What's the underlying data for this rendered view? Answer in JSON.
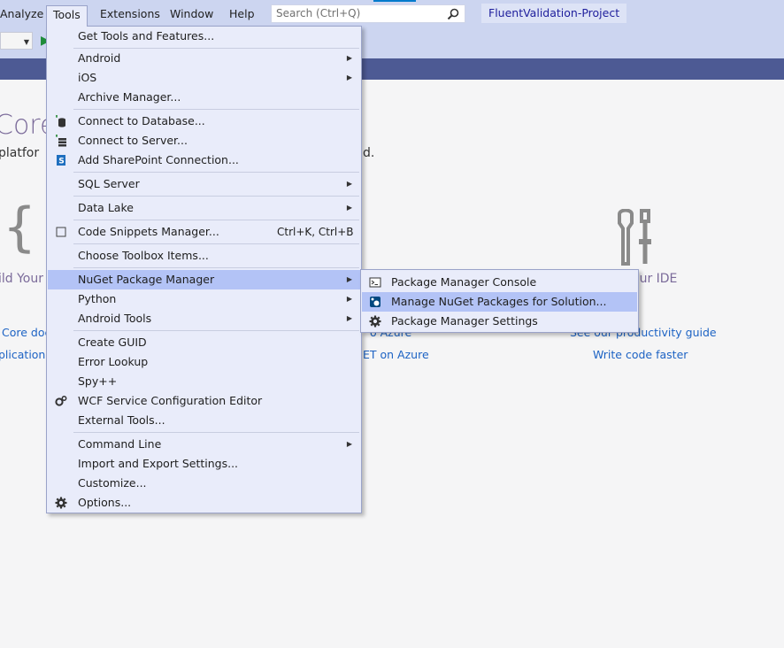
{
  "menubar": {
    "items": [
      {
        "label": "Analyze"
      },
      {
        "label": "Tools"
      },
      {
        "label": "Extensions"
      },
      {
        "label": "Window"
      },
      {
        "label": "Help"
      }
    ],
    "search_placeholder": "Search (Ctrl+Q)",
    "solution_name": "FluentValidation-Project"
  },
  "start_page": {
    "heading": "Core",
    "subtitle_left": "platfor",
    "subtitle_right": "d.",
    "braces": "{ }",
    "build_label": "ild Your",
    "ide_label": "our IDE",
    "links": {
      "core_docs": "Core doc",
      "application": "plication a",
      "azure1": "o Azure",
      "azure2": "ET on Azure",
      "productivity": "See our productivity guide",
      "write_code": "Write code faster"
    }
  },
  "tools_menu": {
    "items": [
      {
        "label": "Get Tools and Features..."
      },
      {
        "label": "Android",
        "submenu": true
      },
      {
        "label": "iOS",
        "submenu": true
      },
      {
        "label": "Archive Manager..."
      },
      {
        "label": "Connect to Database...",
        "icon": "database-icon"
      },
      {
        "label": "Connect to Server...",
        "icon": "server-icon"
      },
      {
        "label": "Add SharePoint Connection...",
        "icon": "sharepoint-icon"
      },
      {
        "label": "SQL Server",
        "submenu": true
      },
      {
        "label": "Data Lake",
        "submenu": true
      },
      {
        "label": "Code Snippets Manager...",
        "shortcut": "Ctrl+K, Ctrl+B",
        "icon": "snippet-icon"
      },
      {
        "label": "Choose Toolbox Items..."
      },
      {
        "label": "NuGet Package Manager",
        "submenu": true,
        "highlighted": true
      },
      {
        "label": "Python",
        "submenu": true
      },
      {
        "label": "Android Tools",
        "submenu": true
      },
      {
        "label": "Create GUID"
      },
      {
        "label": "Error Lookup"
      },
      {
        "label": "Spy++"
      },
      {
        "label": "WCF Service Configuration Editor",
        "icon": "wcf-gear-icon"
      },
      {
        "label": "External Tools..."
      },
      {
        "label": "Command Line",
        "submenu": true
      },
      {
        "label": "Import and Export Settings..."
      },
      {
        "label": "Customize..."
      },
      {
        "label": "Options...",
        "icon": "gear-icon"
      }
    ]
  },
  "nuget_menu": {
    "items": [
      {
        "label": "Package Manager Console",
        "icon": "console-icon"
      },
      {
        "label": "Manage NuGet Packages for Solution...",
        "icon": "nuget-icon",
        "highlighted": true
      },
      {
        "label": "Package Manager Settings",
        "icon": "gear-icon"
      }
    ]
  },
  "colors": {
    "menubar": "#ccd5f0",
    "menu_bg": "#e9ecfa",
    "highlight": "#b3c3f6",
    "doc_tab_strip": "#4d5a94",
    "link": "#1d63c4"
  }
}
